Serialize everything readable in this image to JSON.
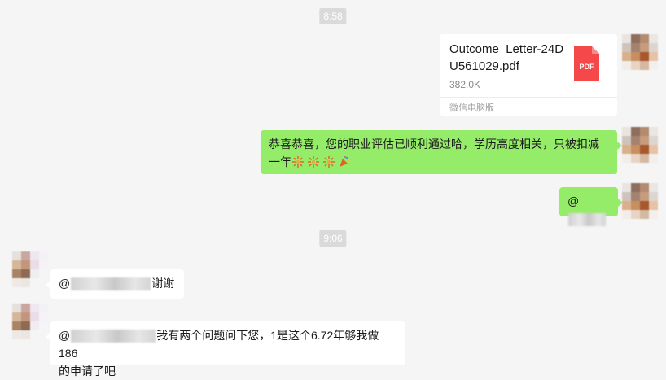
{
  "timestamps": {
    "first": "8:58",
    "second": "9:06"
  },
  "file_message": {
    "file_name": "Outcome_Letter-24DU561029.pdf",
    "file_size": "382.0K",
    "source": "微信电脑版",
    "file_type": "PDF"
  },
  "messages": {
    "congrats": {
      "text": "恭喜恭喜，您的职业评估已顺利通过哈，学历高度相关，只被扣减一年",
      "emojis": [
        "fireworks",
        "fireworks",
        "fireworks",
        "party-popper"
      ]
    },
    "mention_out": {
      "prefix": "@"
    },
    "thanks": {
      "prefix": "@",
      "suffix": "谢谢"
    },
    "question": {
      "prefix": "@",
      "line1": "我有两个问题问下您，1是这个6.72年够我做186",
      "line2": "的申请了吧"
    }
  },
  "colors": {
    "outgoing_bubble": "#95ec69",
    "incoming_bubble": "#ffffff",
    "background": "#f5f5f5",
    "pdf_icon": "#f5484b"
  }
}
